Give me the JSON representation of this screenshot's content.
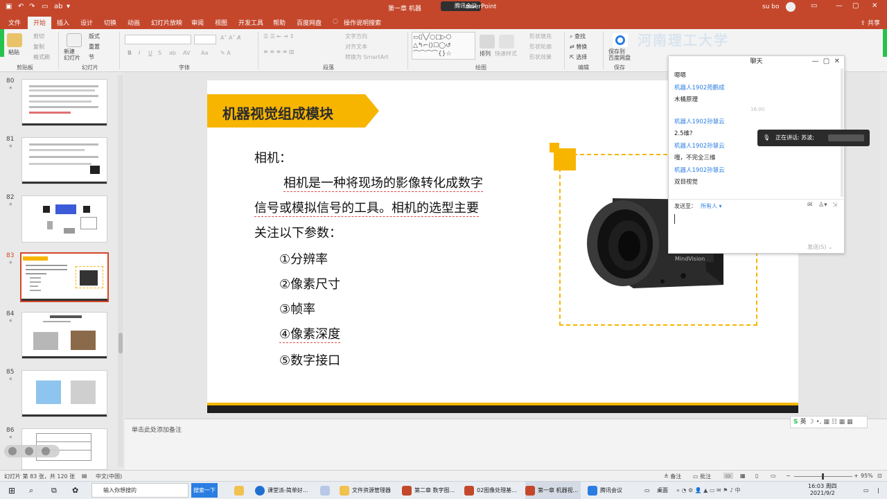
{
  "titlebar": {
    "title_left": "第一章 机器",
    "meeting": "腾讯会议",
    "title_right": "owerPoint",
    "user": "su bo"
  },
  "tabs": [
    "文件",
    "开始",
    "插入",
    "设计",
    "切换",
    "动画",
    "幻灯片放映",
    "审阅",
    "视图",
    "开发工具",
    "帮助",
    "百度网盘",
    "操作说明搜索"
  ],
  "share": "共享",
  "ribbon": {
    "paste": "粘贴",
    "cut": "剪切",
    "copy": "复制",
    "format_painter": "格式刷",
    "clipboard": "剪贴板",
    "new_slide": "新建\n幻灯片",
    "layout": "版式",
    "reset": "重置",
    "section": "节",
    "slides_group": "幻灯片",
    "font_group": "字体",
    "text_dir": "文字方向",
    "align_text": "对齐文本",
    "smartart": "转换为 SmartArt",
    "paragraph_group": "段落",
    "arrange": "排列",
    "quick_styles": "快速样式",
    "shape_fill": "形状填充",
    "shape_outline": "形状轮廓",
    "shape_effects": "形状效果",
    "drawing_group": "绘图",
    "find": "查找",
    "replace": "替换",
    "select": "选择",
    "editing_group": "编辑",
    "save_baidu": "保存到\n百度网盘",
    "save_group": "保存",
    "banner_text": "河南理工大学"
  },
  "thumbnails": [
    {
      "num": "80",
      "star": "*"
    },
    {
      "num": "81",
      "star": "*"
    },
    {
      "num": "82",
      "star": "*"
    },
    {
      "num": "83",
      "star": "*"
    },
    {
      "num": "84",
      "star": "*"
    },
    {
      "num": "85",
      "star": "*"
    },
    {
      "num": "86",
      "star": "*"
    }
  ],
  "slide": {
    "title": "机器视觉组成模块",
    "heading": "相机：",
    "line1": "相机是一种将现场的影像转化成数字",
    "line2": "信号或模拟信号的工具。相机的选型主要",
    "line3": "关注以下参数：",
    "params": [
      "①分辨率",
      "②像素尺寸",
      "③帧率",
      "④像素深度",
      "⑤数字接口"
    ],
    "camera_brand": "MindVision"
  },
  "notes_placeholder": "单击此处添加备注",
  "statusbar": {
    "slide_info": "幻灯片 第 83 张，共 120 张",
    "language": "中文(中国)",
    "notes": "备注",
    "comments": "批注",
    "zoom": "95%"
  },
  "chat": {
    "title": "聊天",
    "messages": [
      {
        "kind": "msg",
        "text": "嗯嗯"
      },
      {
        "kind": "name",
        "text": "机器人1902苑鹏成"
      },
      {
        "kind": "msg",
        "text": "木桶原理"
      },
      {
        "kind": "name",
        "text": "机器人1902孙慧云"
      },
      {
        "kind": "msg",
        "text": "2.5维?"
      },
      {
        "kind": "name",
        "text": "机器人1902孙慧云"
      },
      {
        "kind": "msg",
        "text": "哦，不完全三维"
      },
      {
        "kind": "name",
        "text": "机器人1902孙慧云"
      },
      {
        "kind": "msg",
        "text": "双目视觉"
      }
    ],
    "time": "16:00",
    "send_to_label": "发送至：",
    "send_to_value": "所有人",
    "send_button": "发送(S)"
  },
  "speaking": "正在讲话: 苏波;",
  "ime": "英",
  "taskbar": {
    "search_placeholder": "输入你想搜的",
    "search_button": "搜索一下",
    "apps": [
      {
        "label": "课堂派-简单好...",
        "color": "#1f6fd1"
      },
      {
        "label": "文件资源管理器",
        "color": "#f2c14e"
      },
      {
        "label": "第二章 数字图...",
        "color": "#c4472c"
      },
      {
        "label": "02图像处理基...",
        "color": "#c4472c"
      },
      {
        "label": "第一章 机器视...",
        "color": "#c4472c"
      },
      {
        "label": "腾讯会议",
        "color": "#2a7de1"
      }
    ],
    "desktop": "桌面",
    "time": "16:03 周四",
    "date": "2021/9/2"
  }
}
